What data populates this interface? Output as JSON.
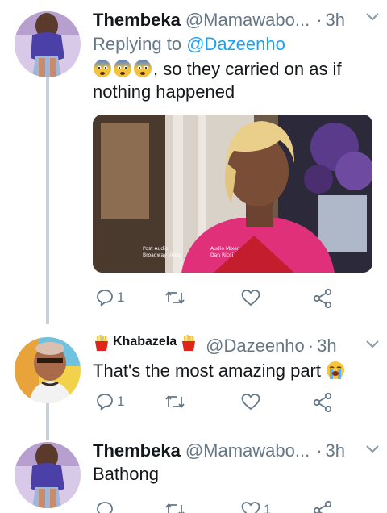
{
  "tweets": [
    {
      "name": "Thembeka",
      "handle": "@Mamawabo...",
      "time": "3h",
      "reply_prefix": "Replying to",
      "reply_mention": "@Dazeenho",
      "text_line1": ", so they carried on as if",
      "text_line2": "nothing happened",
      "emoji": [
        "fearful-face",
        "fearful-face",
        "fearful-face"
      ],
      "media_caption_left": [
        "Post Audio",
        "Broadway Video"
      ],
      "media_caption_right": [
        "Audio Mixer",
        "Dan Ricci"
      ],
      "reply_count": "1",
      "retweet_count": "",
      "like_count": ""
    },
    {
      "name": "Khabazela",
      "name_emoji": "french-fries",
      "handle": "@Dazeenho",
      "time": "3h",
      "text": "That's the most amazing part",
      "text_emoji": "loudly-crying-face",
      "reply_count": "1",
      "retweet_count": "",
      "like_count": ""
    },
    {
      "name": "Thembeka",
      "handle": "@Mamawabo...",
      "time": "3h",
      "text": "Bathong",
      "reply_count": "",
      "retweet_count": "",
      "like_count": "1"
    }
  ],
  "separator": "·",
  "colors": {
    "text": "#14171a",
    "secondary": "#657786",
    "link": "#1da1f2",
    "thread_line": "#c8d1d9"
  }
}
